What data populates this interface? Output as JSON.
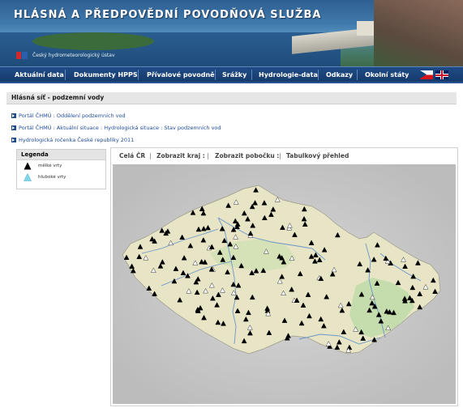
{
  "header": {
    "title": "HLÁSNÁ A PŘEDPOVĚDNÍ POVODŇOVÁ SLUŽBA",
    "org": "Český hydrometeorologický ústav"
  },
  "nav": {
    "items": [
      "Aktuální data",
      "Dokumenty HPPS",
      "Přívalové povodně",
      "Srážky",
      "Hydrologie-data",
      "Odkazy",
      "Okolní státy"
    ],
    "flags": [
      "cz-flag-icon",
      "uk-flag-icon"
    ]
  },
  "page": {
    "title": "Hlásná síť - podzemní vody",
    "links": [
      "Portál ČHMÚ : Oddělení podzemních vod",
      "Portál ČHMÚ : Aktuální situace : Hydrologická situace : Stav podzemních vod",
      "Hydrologická ročenka České republiky 2011"
    ]
  },
  "legend": {
    "title": "Legenda",
    "items": [
      {
        "label": "mělké vrty",
        "color": "#000000",
        "icon": "black-triangle-icon"
      },
      {
        "label": "hluboké vrty",
        "color": "#7fd6ea",
        "icon": "cyan-triangle-icon"
      }
    ]
  },
  "map_toolbar": {
    "items": [
      "Celá ČR",
      "Zobrazit kraj :",
      "Zobrazit pobočku :",
      "Tabulkový přehled"
    ]
  },
  "colors": {
    "nav_bg": "#1a4279",
    "link": "#1f4b9a",
    "map_land": "#e9e6c8",
    "map_green": "#b9d9a8",
    "river": "#5d8fc9"
  }
}
